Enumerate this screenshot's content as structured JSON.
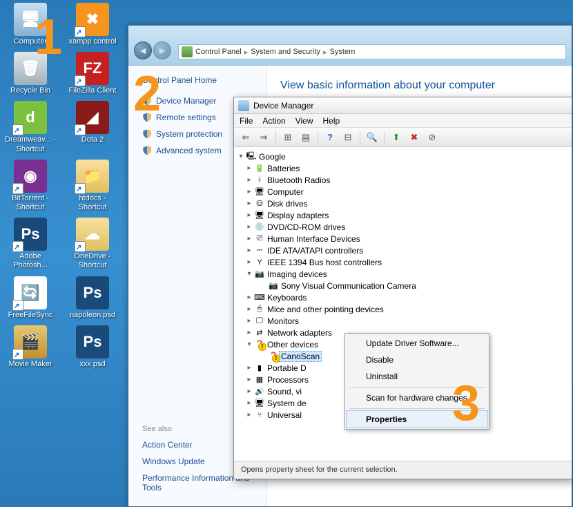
{
  "annotations": {
    "one": "1",
    "two": "2",
    "three": "3"
  },
  "desktop": {
    "icons": [
      {
        "label": "Computer",
        "bg": "linear-gradient(to bottom,#c8e0f0,#88b0d0)",
        "glyph": "🖥",
        "shortcut": false
      },
      {
        "label": "xampp control",
        "bg": "#f7941e",
        "glyph": "✖",
        "shortcut": true
      },
      {
        "label": "Recycle Bin",
        "bg": "linear-gradient(to bottom,#e0e8ec,#a0b0b8)",
        "glyph": "🗑",
        "shortcut": false
      },
      {
        "label": "FileZilla Client",
        "bg": "#c62020",
        "glyph": "FZ",
        "shortcut": true
      },
      {
        "label": "Dreamweav... - Shortcut",
        "bg": "#7cc040",
        "glyph": "d",
        "shortcut": true
      },
      {
        "label": "Dota 2",
        "bg": "#8a1a1a",
        "glyph": "◢",
        "shortcut": true
      },
      {
        "label": "BitTorrent - Shortcut",
        "bg": "#7a3090",
        "glyph": "◉",
        "shortcut": true
      },
      {
        "label": "htdocs - Shortcut",
        "bg": "linear-gradient(to bottom,#f8e0a0,#e0c060)",
        "glyph": "📁",
        "shortcut": true
      },
      {
        "label": "Adobe Photosh...",
        "bg": "#1a4a7a",
        "glyph": "Ps",
        "shortcut": true
      },
      {
        "label": "OneDrive - Shortcut",
        "bg": "linear-gradient(to bottom,#f8e0a0,#e0c060)",
        "glyph": "☁",
        "shortcut": true
      },
      {
        "label": "FreeFileSync",
        "bg": "#fff",
        "glyph": "🔄",
        "shortcut": true
      },
      {
        "label": "napoleon.psd",
        "bg": "#1a4a7a",
        "glyph": "Ps",
        "shortcut": false
      },
      {
        "label": "Movie Maker",
        "bg": "linear-gradient(to bottom,#e8c870,#c09030)",
        "glyph": "🎬",
        "shortcut": true
      },
      {
        "label": "xxx.psd",
        "bg": "#1a4a7a",
        "glyph": "Ps",
        "shortcut": false
      }
    ]
  },
  "control_panel": {
    "breadcrumb": [
      "Control Panel",
      "System and Security",
      "System"
    ],
    "side_title": "Control Panel Home",
    "links": [
      "Device Manager",
      "Remote settings",
      "System protection",
      "Advanced system"
    ],
    "seealso_title": "See also",
    "seealso_links": [
      "Action Center",
      "Windows Update",
      "Performance Information and Tools"
    ],
    "main_title": "View basic information about your computer"
  },
  "device_manager": {
    "title": "Device Manager",
    "menu": [
      "File",
      "Action",
      "View",
      "Help"
    ],
    "root": "Google",
    "categories": [
      {
        "label": "Batteries",
        "glyph": "🔋",
        "expanded": false
      },
      {
        "label": "Bluetooth Radios",
        "glyph": "ᚼ",
        "glyphColor": "#1050a0",
        "expanded": false
      },
      {
        "label": "Computer",
        "glyph": "🖥",
        "expanded": false
      },
      {
        "label": "Disk drives",
        "glyph": "⛁",
        "expanded": false
      },
      {
        "label": "Display adapters",
        "glyph": "🖥",
        "expanded": false
      },
      {
        "label": "DVD/CD-ROM drives",
        "glyph": "💿",
        "expanded": false
      },
      {
        "label": "Human Interface Devices",
        "glyph": "⎚",
        "expanded": false
      },
      {
        "label": "IDE ATA/ATAPI controllers",
        "glyph": "⎓",
        "expanded": false
      },
      {
        "label": "IEEE 1394 Bus host controllers",
        "glyph": "Y",
        "expanded": false
      },
      {
        "label": "Imaging devices",
        "glyph": "📷",
        "expanded": true,
        "children": [
          {
            "label": "Sony Visual Communication Camera",
            "glyph": "📷"
          }
        ]
      },
      {
        "label": "Keyboards",
        "glyph": "⌨",
        "expanded": false
      },
      {
        "label": "Mice and other pointing devices",
        "glyph": "🖱",
        "expanded": false
      },
      {
        "label": "Monitors",
        "glyph": "🖵",
        "expanded": false
      },
      {
        "label": "Network adapters",
        "glyph": "⇄",
        "expanded": false
      },
      {
        "label": "Other devices",
        "glyph": "❓",
        "expanded": true,
        "warn": true,
        "children": [
          {
            "label": "CanoScan",
            "glyph": "❓",
            "warn": true,
            "selected": true
          }
        ]
      },
      {
        "label": "Portable D",
        "glyph": "▮",
        "expanded": false
      },
      {
        "label": "Processors",
        "glyph": "▦",
        "expanded": false
      },
      {
        "label": "Sound, vi",
        "glyph": "🔊",
        "expanded": false
      },
      {
        "label": "System de",
        "glyph": "🖥",
        "expanded": false
      },
      {
        "label": "Universal",
        "glyph": "⑂",
        "expanded": false
      }
    ],
    "status": "Opens property sheet for the current selection."
  },
  "context_menu": {
    "items": [
      {
        "label": "Update Driver Software..."
      },
      {
        "label": "Disable"
      },
      {
        "label": "Uninstall"
      },
      {
        "sep": true
      },
      {
        "label": "Scan for hardware changes"
      },
      {
        "sep": true
      },
      {
        "label": "Properties",
        "highlight": true
      }
    ]
  }
}
